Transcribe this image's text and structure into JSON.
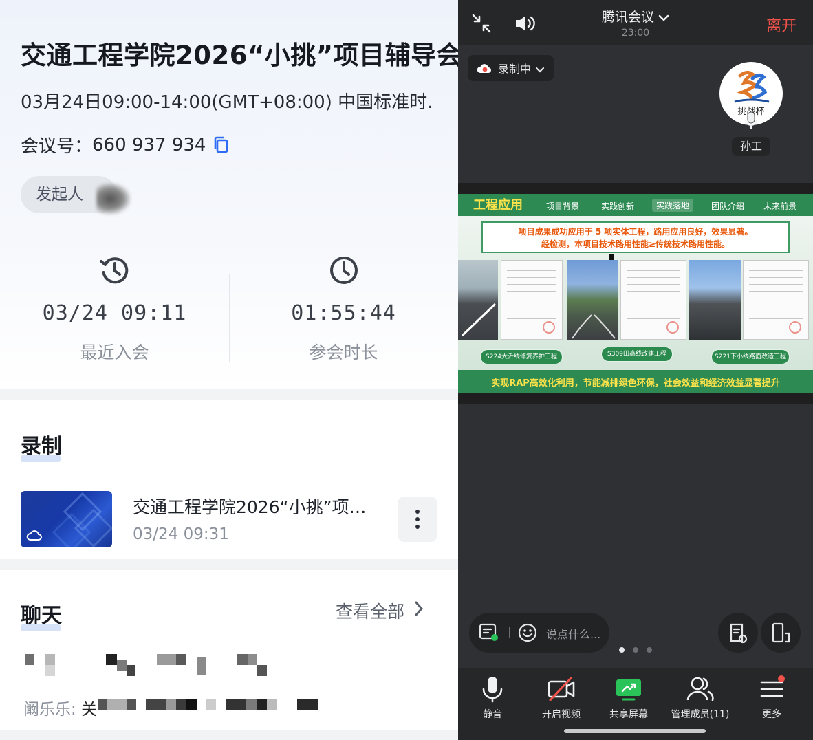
{
  "left": {
    "title": "交通工程学院2026“小挑”项目辅导会",
    "time_range": "03月24日09:00-14:00(GMT+08:00) 中国标准时…",
    "meeting_id_label": "会议号：",
    "meeting_id": "660 937 934",
    "host_label": "发起人",
    "stats": [
      {
        "value": "03/24 09:11",
        "label": "最近入会",
        "icon": "history-clock-icon"
      },
      {
        "value": "01:55:44",
        "label": "参会时长",
        "icon": "clock-icon"
      }
    ],
    "recording_section_title": "录制",
    "recording": {
      "title": "交通工程学院2026“小挑”项…",
      "date": "03/24 09:31"
    },
    "chat_section_title": "聊天",
    "view_all": "查看全部",
    "chat_sender_label": "阚乐乐: ",
    "chat_preview_char": "关"
  },
  "right": {
    "app_title": "腾讯会议",
    "clock": "23:00",
    "leave": "离开",
    "recording_status": "录制中",
    "participant_name": "孙工",
    "avatar_text": "挑战杯",
    "slide": {
      "section_title": "工程应用",
      "nav": [
        "项目背景",
        "实践创新",
        "实践落地",
        "团队介绍",
        "未来前景"
      ],
      "nav_active": "实践落地",
      "banner_line1": "项目成果成功应用于 5 项实体工程，路用应用良好，效果显著。",
      "banner_line2": "经检测，本项目技术路用性能≥传统技术路用性能。",
      "projects": [
        "S224大沂线修复养护工程",
        "S309田高线改建工程",
        "S221下小线路面改造工程"
      ],
      "footer": "实现RAP高效化利用，节能减排绿色环保，社会效益和经济效益显著提升"
    },
    "chat_placeholder": "说点什么...",
    "toolbar": [
      {
        "label": "静音",
        "icon": "microphone-icon"
      },
      {
        "label": "开启视频",
        "icon": "video-off-icon"
      },
      {
        "label": "共享屏幕",
        "icon": "share-screen-icon"
      },
      {
        "label": "管理成员(11)",
        "icon": "members-icon"
      },
      {
        "label": "更多",
        "icon": "more-menu-icon"
      }
    ],
    "colors": {
      "accent_blue": "#2f6cf6",
      "leave_red": "#f0524a",
      "share_green": "#29c35a",
      "slide_green": "#2d8a52",
      "slide_yellow": "#ffe34a"
    }
  }
}
